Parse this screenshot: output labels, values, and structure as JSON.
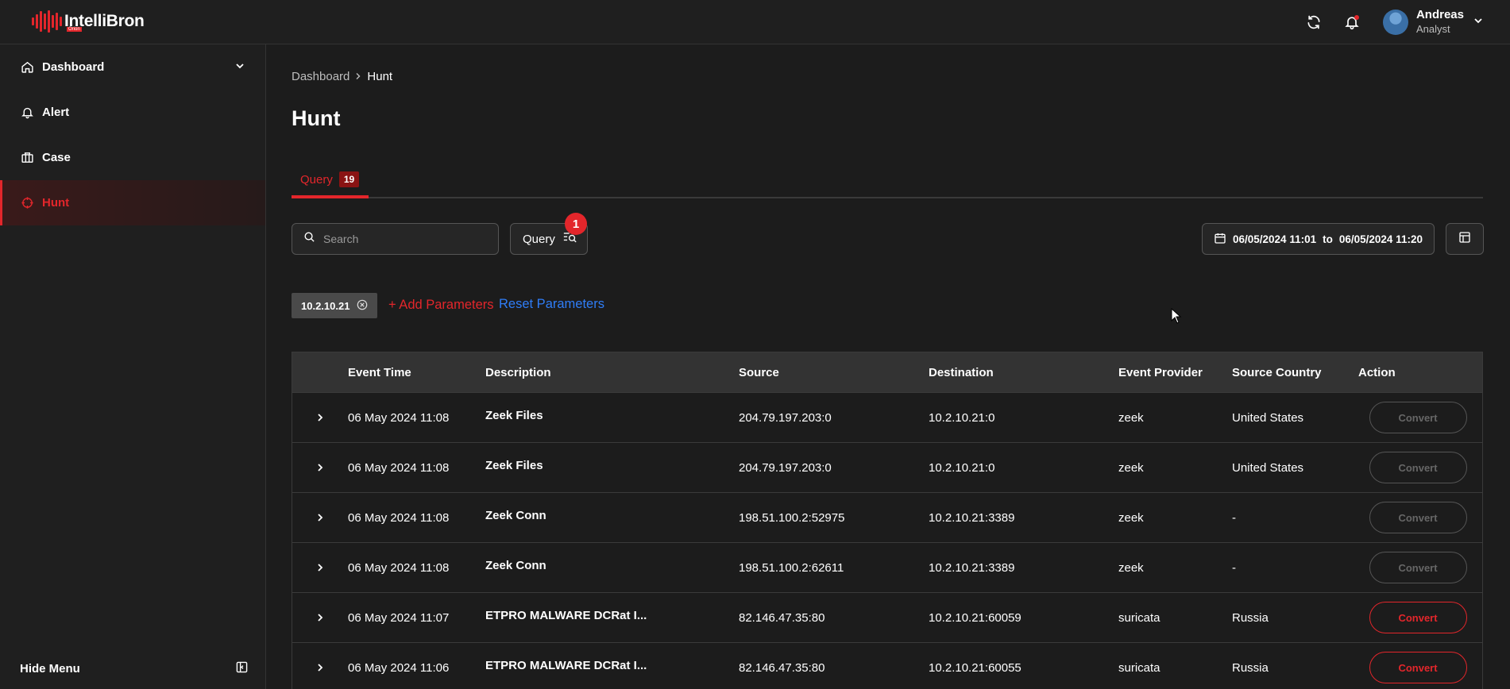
{
  "brand": {
    "name": "IntelliBron",
    "tagline": "Orion"
  },
  "user": {
    "name": "Andreas",
    "role": "Analyst"
  },
  "sidebar": {
    "items": [
      {
        "label": "Dashboard",
        "icon": "home-icon",
        "expandable": true
      },
      {
        "label": "Alert",
        "icon": "bell-icon"
      },
      {
        "label": "Case",
        "icon": "briefcase-icon"
      },
      {
        "label": "Hunt",
        "icon": "crosshair-icon",
        "active": true
      }
    ],
    "hide_menu_label": "Hide Menu"
  },
  "breadcrumb": {
    "parent": "Dashboard",
    "current": "Hunt"
  },
  "page_title": "Hunt",
  "tabs": [
    {
      "label": "Query",
      "count": "19"
    }
  ],
  "toolbar": {
    "search_placeholder": "Search",
    "query_label": "Query",
    "query_badge": "1",
    "date_from": "06/05/2024 11:01",
    "date_to_label": "to",
    "date_to": "06/05/2024 11:20"
  },
  "parameters": {
    "chips": [
      "10.2.10.21"
    ],
    "add_label": "+ Add Parameters",
    "reset_label": "Reset Parameters"
  },
  "table": {
    "columns": [
      "Event Time",
      "Description",
      "Source",
      "Destination",
      "Event Provider",
      "Source Country",
      "Action"
    ],
    "rows": [
      {
        "time": "06 May 2024 11:08",
        "description": "Zeek Files",
        "source": "204.79.197.203:0",
        "destination": "10.2.10.21:0",
        "provider": "zeek",
        "country": "United States",
        "action": "Convert",
        "action_enabled": false
      },
      {
        "time": "06 May 2024 11:08",
        "description": "Zeek Files",
        "source": "204.79.197.203:0",
        "destination": "10.2.10.21:0",
        "provider": "zeek",
        "country": "United States",
        "action": "Convert",
        "action_enabled": false
      },
      {
        "time": "06 May 2024 11:08",
        "description": "Zeek Conn",
        "source": "198.51.100.2:52975",
        "destination": "10.2.10.21:3389",
        "provider": "zeek",
        "country": "-",
        "action": "Convert",
        "action_enabled": false
      },
      {
        "time": "06 May 2024 11:08",
        "description": "Zeek Conn",
        "source": "198.51.100.2:62611",
        "destination": "10.2.10.21:3389",
        "provider": "zeek",
        "country": "-",
        "action": "Convert",
        "action_enabled": false
      },
      {
        "time": "06 May 2024 11:07",
        "description": "ETPRO MALWARE DCRat I...",
        "source": "82.146.47.35:80",
        "destination": "10.2.10.21:60059",
        "provider": "suricata",
        "country": "Russia",
        "action": "Convert",
        "action_enabled": true
      },
      {
        "time": "06 May 2024 11:06",
        "description": "ETPRO MALWARE DCRat I...",
        "source": "82.146.47.35:80",
        "destination": "10.2.10.21:60055",
        "provider": "suricata",
        "country": "Russia",
        "action": "Convert",
        "action_enabled": true
      }
    ]
  },
  "colors": {
    "accent": "#e3262b",
    "link": "#2f7df7",
    "background": "#1c1c1c"
  }
}
